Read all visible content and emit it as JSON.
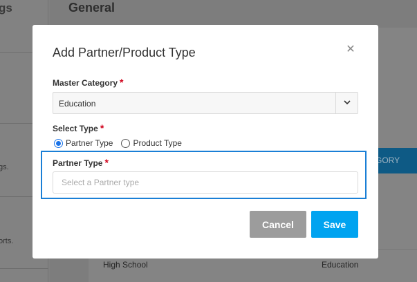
{
  "background": {
    "sidebar_title": "gs",
    "sidebar_texts": [
      "gs.",
      "orts."
    ],
    "page_title": "General",
    "tab_bar_label": "EGORY",
    "row": {
      "label": "High School",
      "value": "Education"
    }
  },
  "modal": {
    "title": "Add Partner/Product Type",
    "close_icon": "close-icon",
    "master_category": {
      "label": "Master Category",
      "required": "*",
      "selected": "Education"
    },
    "select_type": {
      "label": "Select Type",
      "required": "*",
      "options": [
        "Partner Type",
        "Product Type"
      ],
      "selected": "Partner Type"
    },
    "partner_type": {
      "label": "Partner Type",
      "required": "*",
      "value": "",
      "placeholder": "Select a Partner type"
    },
    "buttons": {
      "cancel": "Cancel",
      "save": "Save"
    }
  },
  "colors": {
    "accent": "#1a73e8",
    "save_button": "#00a3f0",
    "cancel_button": "#9c9c9c",
    "required": "#d0021b"
  }
}
